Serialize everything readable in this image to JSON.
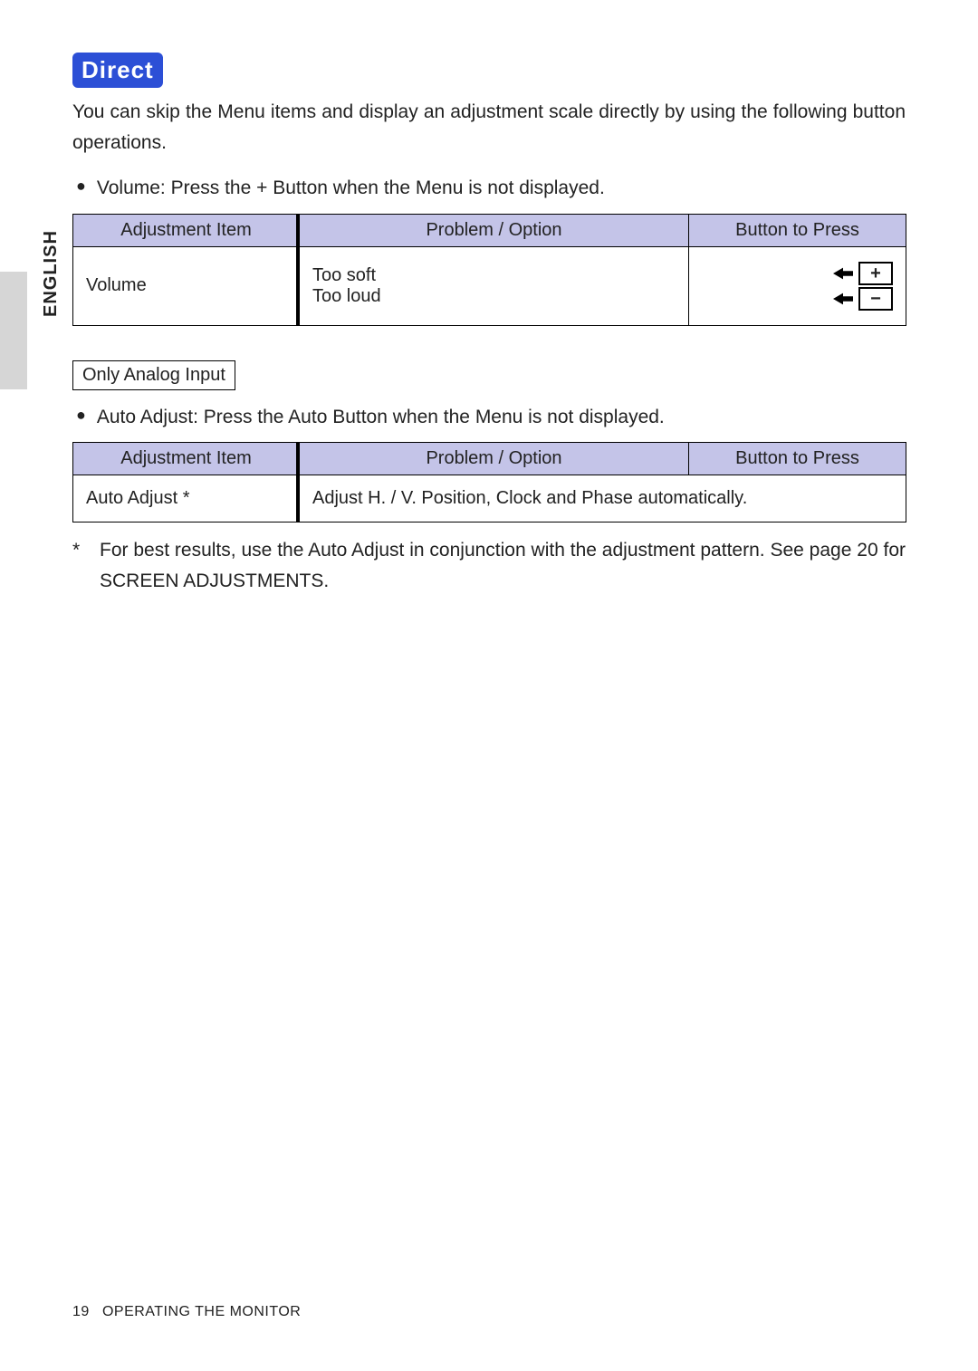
{
  "language_tab": "ENGLISH",
  "badge": "Direct",
  "intro": "You can skip the Menu items and display an adjustment scale directly by using the following button operations.",
  "bullets": {
    "volume": "Volume: Press the + Button when the Menu is not displayed.",
    "auto": "Auto Adjust: Press the Auto Button when the Menu is not displayed."
  },
  "table_headers": {
    "col1": "Adjustment Item",
    "col2": "Problem / Option",
    "col3": "Button to Press"
  },
  "table1": {
    "item": "Volume",
    "problem_line1": "Too soft",
    "problem_line2": "Too loud",
    "btn_plus": "+",
    "btn_minus": "−"
  },
  "analog_box": "Only Analog Input",
  "table2": {
    "item": "Auto Adjust *",
    "problem": "Adjust H. / V. Position, Clock and Phase automatically."
  },
  "footnote_symbol": "*",
  "footnote_text": "For best results, use the Auto Adjust in conjunction with the adjustment pattern. See page 20 for SCREEN ADJUSTMENTS.",
  "footer": {
    "page_no": "19",
    "section": "OPERATING THE MONITOR"
  }
}
